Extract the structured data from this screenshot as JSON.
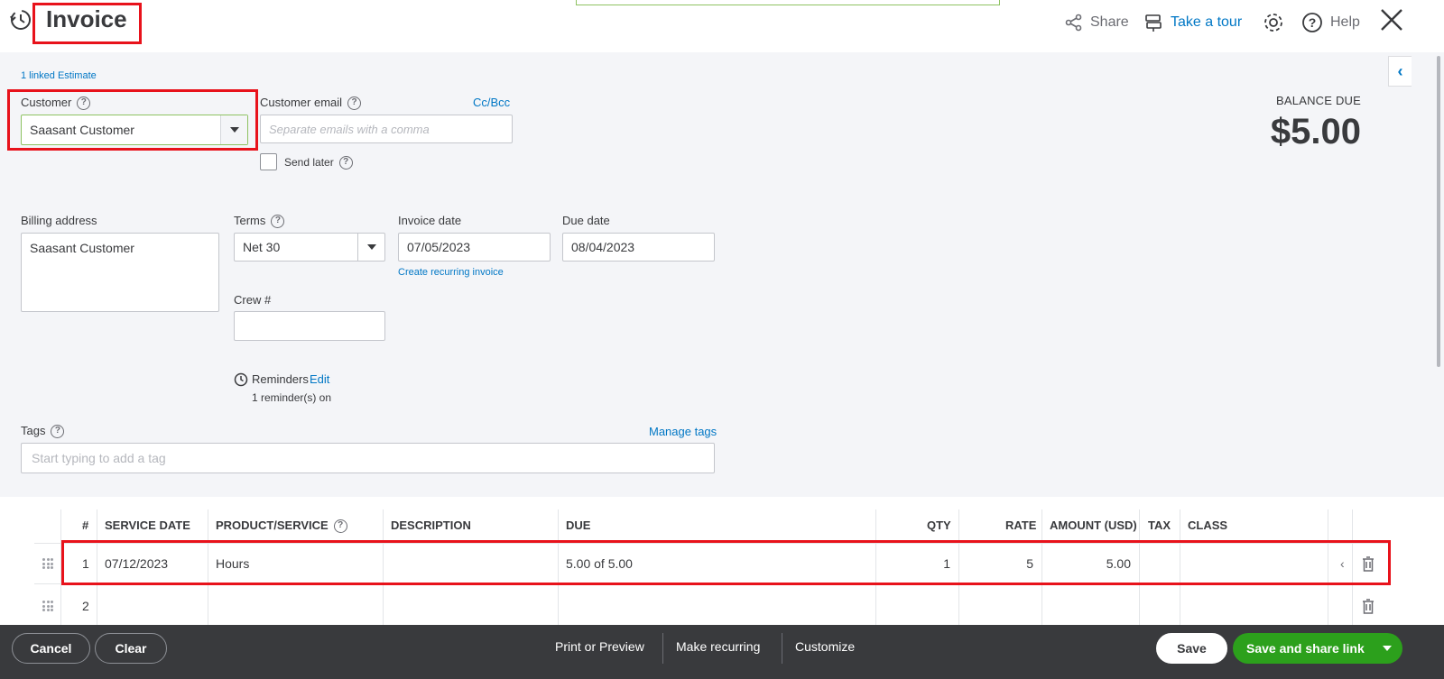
{
  "header": {
    "title": "Invoice",
    "share_label": "Share",
    "tour_label": "Take a tour",
    "help_label": "Help"
  },
  "linked_estimate": "1 linked Estimate",
  "customer": {
    "label": "Customer",
    "value": "Saasant Customer"
  },
  "customer_email": {
    "label": "Customer email",
    "placeholder": "Separate emails with a comma",
    "cc_bcc": "Cc/Bcc",
    "send_later": "Send later"
  },
  "balance": {
    "label": "BALANCE DUE",
    "amount": "$5.00"
  },
  "billing_address": {
    "label": "Billing address",
    "value": "Saasant Customer"
  },
  "terms": {
    "label": "Terms",
    "value": "Net 30"
  },
  "invoice_date": {
    "label": "Invoice date",
    "value": "07/05/2023",
    "recurring_link": "Create recurring invoice"
  },
  "due_date": {
    "label": "Due date",
    "value": "08/04/2023"
  },
  "crew": {
    "label": "Crew #",
    "value": ""
  },
  "reminders": {
    "label": "Reminders",
    "edit": "Edit",
    "status": "1 reminder(s) on"
  },
  "tags": {
    "label": "Tags",
    "manage": "Manage tags",
    "placeholder": "Start typing to add a tag"
  },
  "table": {
    "headers": {
      "num": "#",
      "service_date": "SERVICE DATE",
      "product": "PRODUCT/SERVICE",
      "description": "DESCRIPTION",
      "due": "DUE",
      "qty": "QTY",
      "rate": "RATE",
      "amount": "AMOUNT (USD)",
      "tax": "TAX",
      "class": "CLASS"
    },
    "rows": [
      {
        "num": "1",
        "service_date": "07/12/2023",
        "product": "Hours",
        "description": "",
        "due": "5.00 of 5.00",
        "qty": "1",
        "rate": "5",
        "amount": "5.00",
        "tax": "",
        "class": ""
      },
      {
        "num": "2",
        "service_date": "",
        "product": "",
        "description": "",
        "due": "",
        "qty": "",
        "rate": "",
        "amount": "",
        "tax": "",
        "class": ""
      }
    ]
  },
  "footer": {
    "cancel": "Cancel",
    "clear": "Clear",
    "print_preview": "Print or Preview",
    "make_recurring": "Make recurring",
    "customize": "Customize",
    "save": "Save",
    "save_share": "Save and share link"
  },
  "colors": {
    "accent_blue": "#0077c5",
    "primary_green": "#2ca01c",
    "highlight_red": "#e8121b",
    "footer_bg": "#393a3d"
  }
}
